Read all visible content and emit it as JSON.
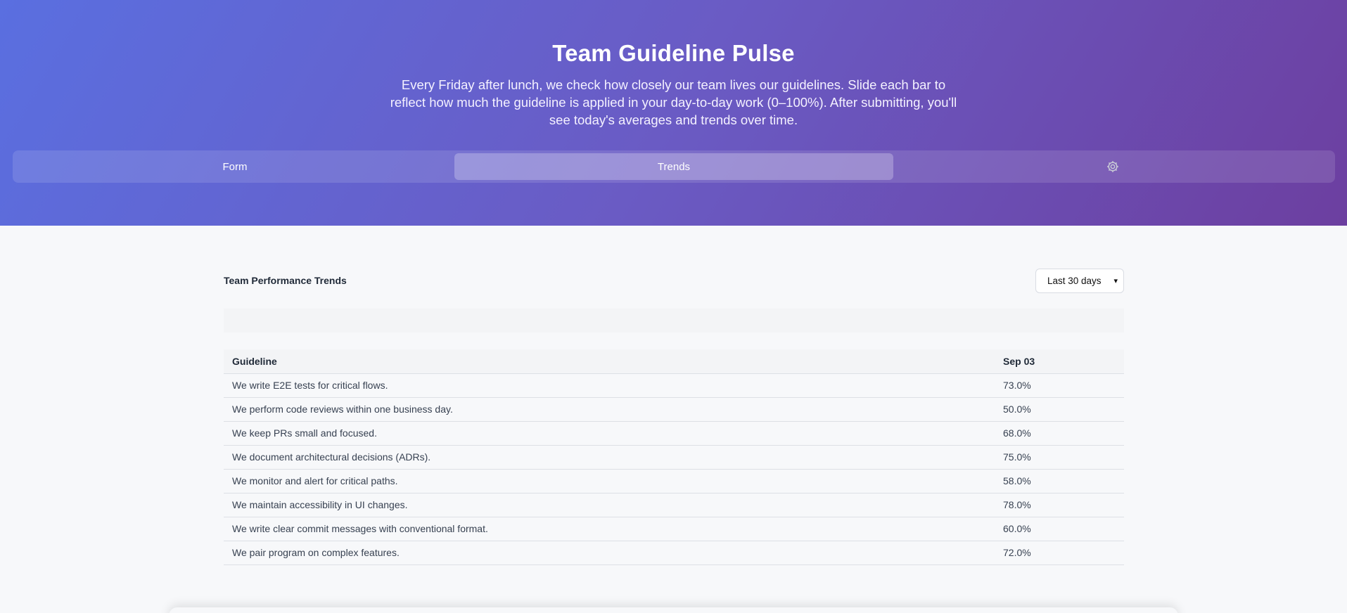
{
  "header": {
    "title": "Team Guideline Pulse",
    "subtitle": "Every Friday after lunch, we check how closely our team lives our guidelines. Slide each bar to reflect how much the guideline is applied in your day-to-day work (0–100%). After submitting, you'll see today's averages and trends over time."
  },
  "tabs": [
    {
      "label": "Form",
      "active": false
    },
    {
      "label": "Trends",
      "active": true
    },
    {
      "label": "",
      "icon": "gear-icon",
      "active": false
    }
  ],
  "trends": {
    "title": "Team Performance Trends",
    "range": {
      "selected": "Last 30 days"
    },
    "table": {
      "headers": [
        "Guideline",
        "Sep 03"
      ],
      "rows": [
        [
          "We write E2E tests for critical flows.",
          "73.0%"
        ],
        [
          "We perform code reviews within one business day.",
          "50.0%"
        ],
        [
          "We keep PRs small and focused.",
          "68.0%"
        ],
        [
          "We document architectural decisions (ADRs).",
          "75.0%"
        ],
        [
          "We monitor and alert for critical paths.",
          "58.0%"
        ],
        [
          "We maintain accessibility in UI changes.",
          "78.0%"
        ],
        [
          "We write clear commit messages with conventional format.",
          "60.0%"
        ],
        [
          "We pair program on complex features.",
          "72.0%"
        ]
      ]
    }
  },
  "colors": {
    "gradient_start": "#5a6fe0",
    "gradient_end": "#6c3fa0",
    "background": "#f7f8fa"
  }
}
